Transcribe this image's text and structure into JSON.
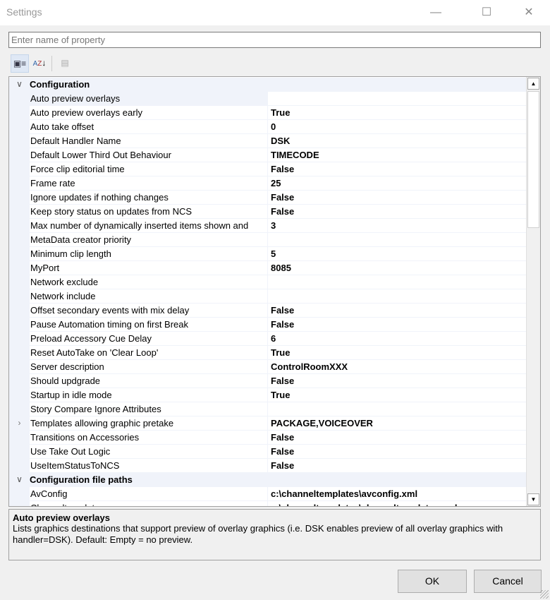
{
  "window": {
    "title": "Settings"
  },
  "search": {
    "placeholder": "Enter name of property",
    "value": ""
  },
  "toolbar": {
    "categorized": "categorized-view",
    "alphabetical": "alphabetical-sort",
    "property_pages": "property-pages"
  },
  "categories": [
    {
      "label": "Configuration",
      "expanded": true,
      "rows": [
        {
          "name": "Auto preview overlays",
          "value": "",
          "selected": true
        },
        {
          "name": "Auto preview overlays early",
          "value": "True"
        },
        {
          "name": "Auto take offset",
          "value": "0"
        },
        {
          "name": "Default Handler Name",
          "value": "DSK"
        },
        {
          "name": "Default Lower Third Out Behaviour",
          "value": "TIMECODE"
        },
        {
          "name": "Force clip editorial time",
          "value": "False"
        },
        {
          "name": "Frame rate",
          "value": "25"
        },
        {
          "name": "Ignore updates if nothing changes",
          "value": "False"
        },
        {
          "name": "Keep story status on updates from NCS",
          "value": "False"
        },
        {
          "name": "Max number of dynamically inserted items shown and",
          "value": "3"
        },
        {
          "name": "MetaData creator priority",
          "value": ""
        },
        {
          "name": "Minimum clip length",
          "value": "5"
        },
        {
          "name": "MyPort",
          "value": "8085"
        },
        {
          "name": "Network exclude",
          "value": ""
        },
        {
          "name": "Network include",
          "value": ""
        },
        {
          "name": "Offset secondary events with mix delay",
          "value": "False"
        },
        {
          "name": "Pause Automation timing on first Break",
          "value": "False"
        },
        {
          "name": "Preload Accessory Cue Delay",
          "value": "6"
        },
        {
          "name": "Reset AutoTake on 'Clear Loop'",
          "value": "True"
        },
        {
          "name": "Server description",
          "value": "ControlRoomXXX"
        },
        {
          "name": "Should updgrade",
          "value": "False"
        },
        {
          "name": "Startup in idle mode",
          "value": "True"
        },
        {
          "name": "Story Compare Ignore Attributes",
          "value": ""
        },
        {
          "name": "Templates allowing graphic pretake",
          "value": "PACKAGE,VOICEOVER",
          "expandable": true
        },
        {
          "name": "Transitions on Accessories",
          "value": "False"
        },
        {
          "name": "Use Take Out Logic",
          "value": "False"
        },
        {
          "name": "UseItemStatusToNCS",
          "value": "False"
        }
      ]
    },
    {
      "label": "Configuration file paths",
      "expanded": true,
      "rows": [
        {
          "name": "AvConfig",
          "value": "c:\\channeltemplates\\avconfig.xml"
        },
        {
          "name": "Channeltemplates",
          "value": "c:\\channeltemplates\\channeltemplates.xml"
        }
      ]
    }
  ],
  "description": {
    "title": "Auto preview overlays",
    "text": "Lists graphics destinations that support preview of overlay graphics (i.e. DSK enables preview of all overlay graphics with handler=DSK). Default: Empty = no preview."
  },
  "buttons": {
    "ok": "OK",
    "cancel": "Cancel"
  }
}
